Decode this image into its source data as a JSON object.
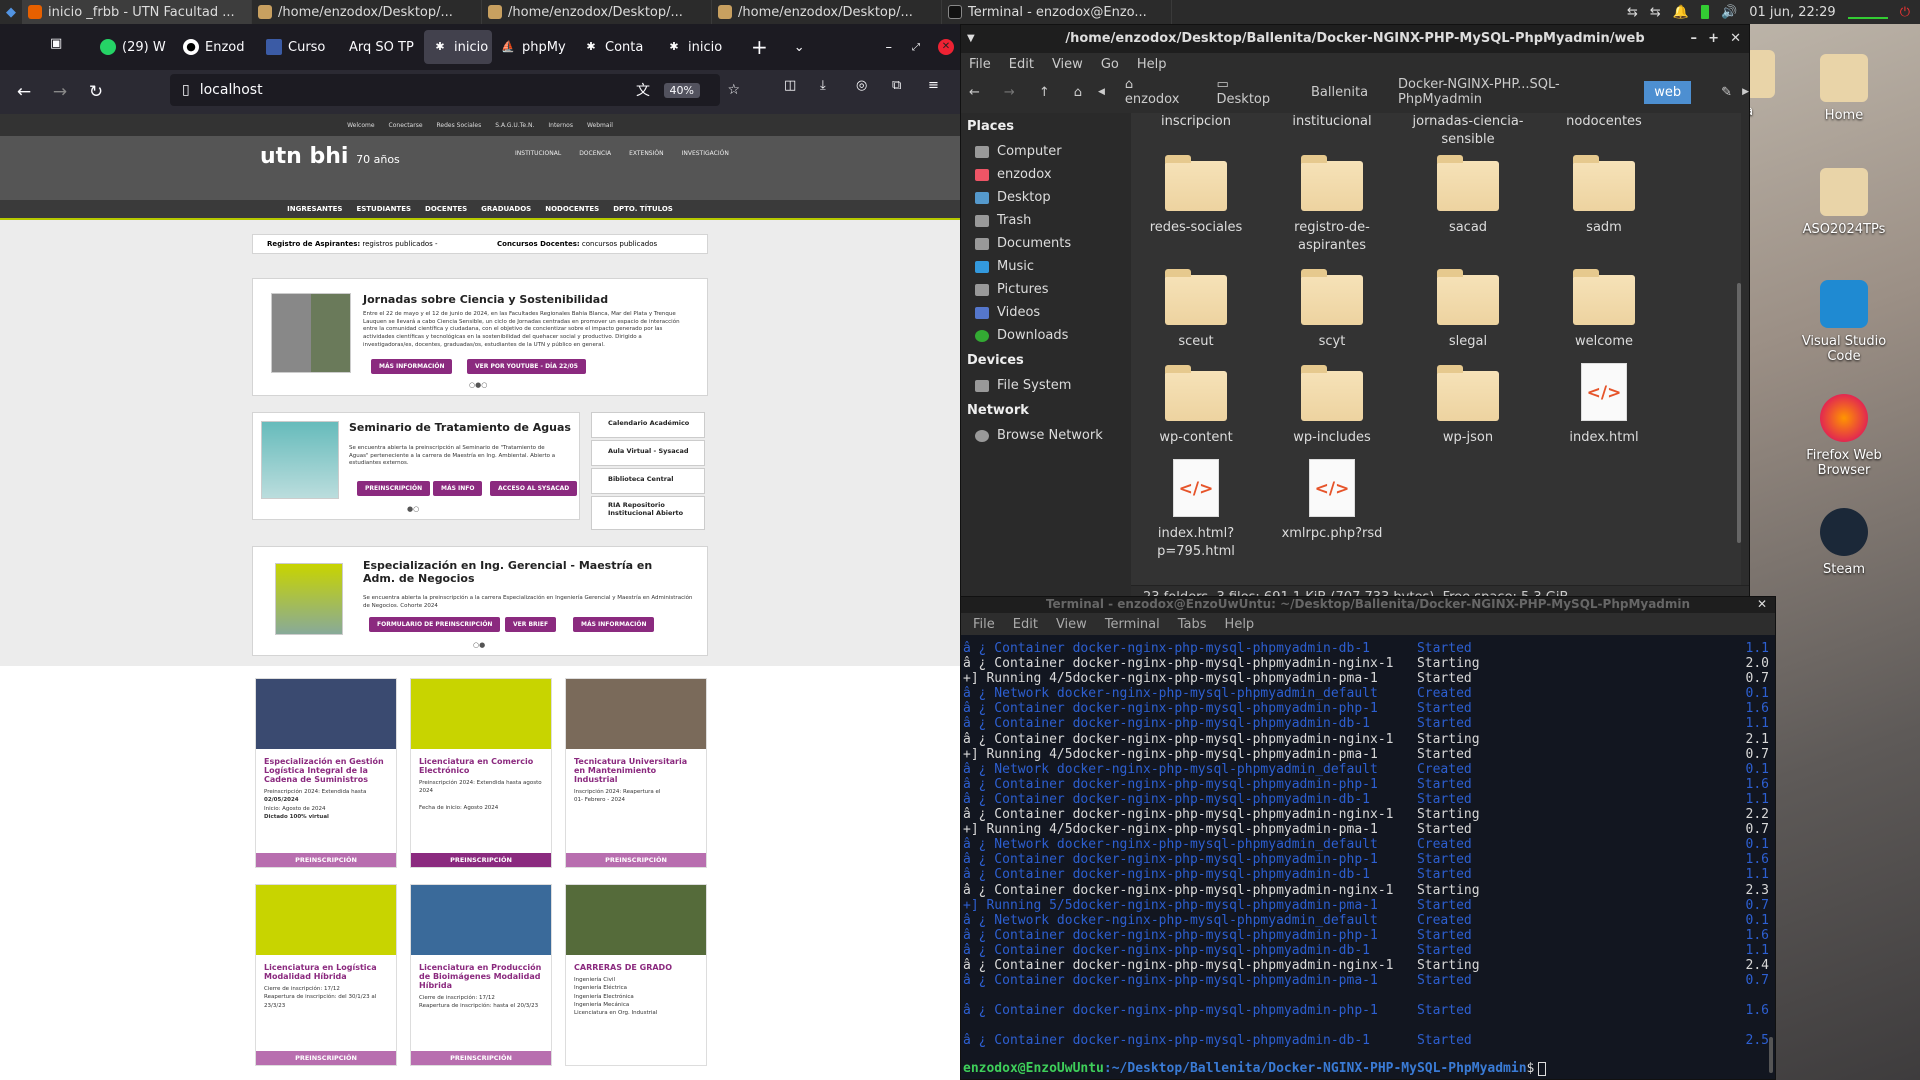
{
  "top_panel": {
    "tasks": [
      {
        "label": "inicio _frbb - UTN Facultad ...",
        "icon": "firefox-icon",
        "color": "#e66000"
      },
      {
        "label": "/home/enzodox/Desktop/...",
        "icon": "folder-icon",
        "color": "#c8a060"
      },
      {
        "label": "/home/enzodox/Desktop/...",
        "icon": "folder-icon",
        "color": "#c8a060"
      },
      {
        "label": "/home/enzodox/Desktop/...",
        "icon": "folder-icon",
        "color": "#c8a060"
      },
      {
        "label": "Terminal - enzodox@Enzo...",
        "icon": "terminal-icon",
        "color": "#333333"
      }
    ],
    "clock": "01 jun, 22:29"
  },
  "desktop_icons": [
    {
      "label": "Home"
    },
    {
      "label": "ASO2024TPs"
    },
    {
      "label": "Visual Studio Code"
    },
    {
      "label": "Firefox Web Browser"
    },
    {
      "label": "Steam"
    },
    {
      "label": "ta"
    }
  ],
  "firefox": {
    "tabs": [
      "(29) W",
      "Enzod",
      "Curso",
      "Arq SO TP",
      "inicio",
      "phpMy",
      "Conta",
      "inicio"
    ],
    "url": "localhost",
    "zoom": "40%"
  },
  "webpage": {
    "util_links": [
      "Welcome",
      "Conectarse",
      "Redes Sociales",
      "S.A.G.U.Te.N.",
      "Internos",
      "Webmail"
    ],
    "logo": "utn bhi",
    "logo_years": "70 años",
    "top_menu": [
      "INSTITUCIONAL",
      "DOCENCIA",
      "EXTENSIÓN",
      "INVESTIGACIÓN"
    ],
    "main_menu": [
      "INGRESANTES",
      "ESTUDIANTES",
      "DOCENTES",
      "GRADUADOS",
      "NODOCENTES",
      "DPTO. TÍTULOS"
    ],
    "ticker_left_bold": "Registro de Aspirantes:",
    "ticker_left": "registros publicados -",
    "ticker_right_bold": "Concursos Docentes:",
    "ticker_right": "concursos publicados",
    "slide1": {
      "title": "Jornadas sobre Ciencia y Sostenibilidad",
      "text": "Entre el 22 de mayo y el 12 de junio de 2024, en las Facultades Regionales Bahía Blanca, Mar del Plata y Trenque Lauquen se llevará a cabo Ciencia Sensible, un ciclo de Jornadas centradas en promover un espacio de interacción entre la comunidad científica y ciudadana, con el objetivo de concientizar sobre el impacto generado por las actividades científicas y tecnológicas en la sostenibilidad del quehacer social y productivo. Dirigido a investigadoras/es, docentes, graduadas/os, estudiantes de la UTN y público en general.",
      "btn1": "MÁS INFORMACIÓN",
      "btn2": "VER POR YOUTUBE - DÍA 22/05"
    },
    "slide2": {
      "title": "Seminario de Tratamiento de Aguas",
      "text": "Se encuentra abierta la preinscripción al Seminario de \"Tratamiento de Aguas\" perteneciente a la carrera de Maestría en Ing. Ambiental. Abierto a estudiantes externos.",
      "btn1": "PREINSCRIPCIÓN",
      "btn2": "MÁS INFO",
      "btn3": "ACCESO AL SYSACAD"
    },
    "quick_links": [
      "Calendario Académico",
      "Aula Virtual - Sysacad",
      "Biblioteca Central",
      "RIA Repositorio Institucional Abierto"
    ],
    "slide3": {
      "title": "Especialización en Ing. Gerencial - Maestría en Adm. de Negocios",
      "text": "Se encuentra abierta la preinscripción a la carrera Especialización en Ingeniería Gerencial y Maestría en Administración de Negocios. Cohorte 2024",
      "btn1": "FORMULARIO DE PREINSCRIPCIÓN",
      "btn2": "VER BRIEF",
      "btn3": "MÁS INFORMACIÓN"
    },
    "program_cards": [
      {
        "title": "Especialización en Gestión Logística Integral de la Cadena de Suministros",
        "lines": [
          "Preinscripción 2024: Extendida hasta",
          "02/05/2024",
          "Inicio: Agosto de 2024",
          "Dictado 100% virtual"
        ],
        "button": "PREINSCRIPCIÓN",
        "img": "#3a4a70"
      },
      {
        "title": "Licenciatura en Comercio Electrónico",
        "lines": [
          "Preinscripción 2024: Extendida hasta agosto 2024",
          "",
          "Fecha de inicio: Agosto 2024"
        ],
        "button": "PREINSCRIPCIÓN",
        "img": "#c8d400"
      },
      {
        "title": "Tecnicatura Universitaria en Mantenimiento Industrial",
        "lines": [
          "Inscripción 2024: Reapertura el",
          "01- Febrero - 2024"
        ],
        "button": "PREINSCRIPCIÓN",
        "img": "#7a6a5a"
      },
      {
        "title": "Licenciatura en Logística Modalidad Híbrida",
        "lines": [
          "Cierre de inscripción: 17/12",
          "Reapertura de inscripción: del 30/1/23 al 23/3/23"
        ],
        "button": "PREINSCRIPCIÓN",
        "img": "#c8d400"
      },
      {
        "title": "Licenciatura en Producción de Bioimágenes Modalidad Híbrida",
        "lines": [
          "Cierre de inscripción: 17/12",
          "Reapertura de inscripción: hasta el 20/3/23"
        ],
        "button": "PREINSCRIPCIÓN",
        "img": "#3a6a9a"
      },
      {
        "title": "CARRERAS DE GRADO",
        "lines": [
          "Ingeniería Civil",
          "Ingeniería Eléctrica",
          "Ingeniería Electrónica",
          "Ingeniería Mecánica",
          "Licenciatura en Org. Industrial"
        ],
        "button": "",
        "img": "#556b3a"
      }
    ]
  },
  "file_manager": {
    "title": "/home/enzodox/Desktop/Ballenita/Docker-NGINX-PHP-MySQL-PhpMyadmin/web",
    "menu": [
      "File",
      "Edit",
      "View",
      "Go",
      "Help"
    ],
    "breadcrumbs": [
      "enzodox",
      "Desktop",
      "Ballenita",
      "Docker-NGINX-PHP...SQL-PhpMyadmin",
      "web"
    ],
    "places_header": "Places",
    "places": [
      "Computer",
      "enzodox",
      "Desktop",
      "Trash",
      "Documents",
      "Music",
      "Pictures",
      "Videos",
      "Downloads"
    ],
    "devices_header": "Devices",
    "devices": [
      "File System"
    ],
    "network_header": "Network",
    "network": [
      "Browse Network"
    ],
    "top_row": [
      "inscripcion",
      "institucional",
      "jornadas-ciencia-\nsensible",
      "nodocentes"
    ],
    "items": [
      {
        "name": "redes-sociales",
        "type": "folder"
      },
      {
        "name": "registro-de-\naspirantes",
        "type": "folder"
      },
      {
        "name": "sacad",
        "type": "folder"
      },
      {
        "name": "sadm",
        "type": "folder"
      },
      {
        "name": "sceut",
        "type": "folder"
      },
      {
        "name": "scyt",
        "type": "folder"
      },
      {
        "name": "slegal",
        "type": "folder"
      },
      {
        "name": "welcome",
        "type": "folder"
      },
      {
        "name": "wp-content",
        "type": "folder"
      },
      {
        "name": "wp-includes",
        "type": "folder"
      },
      {
        "name": "wp-json",
        "type": "folder"
      },
      {
        "name": "index.html",
        "type": "html"
      },
      {
        "name": "index.html?\np=795.html",
        "type": "html"
      },
      {
        "name": "xmlrpc.php?rsd",
        "type": "html"
      }
    ],
    "status": "23 folders, 3 files: 691,1 KiB (707.733 bytes), Free space: 5,3 GiB"
  },
  "terminal": {
    "title": "Terminal - enzodox@EnzoUwUntu: ~/Desktop/Ballenita/Docker-NGINX-PHP-MySQL-PhpMyadmin",
    "menu": [
      "File",
      "Edit",
      "View",
      "Terminal",
      "Tabs",
      "Help"
    ],
    "lines": [
      {
        "t": "â ¿ Container docker-nginx-php-mysql-phpmyadmin-db-1      Started",
        "c": "b",
        "n": "1.1"
      },
      {
        "t": "â ¿ Container docker-nginx-php-mysql-phpmyadmin-nginx-1   Starting",
        "c": "w",
        "n": "2.0"
      },
      {
        "t": "+] Running 4/5docker-nginx-php-mysql-phpmyadmin-pma-1     Started",
        "c": "w",
        "n": "0.7"
      },
      {
        "t": "â ¿ Network docker-nginx-php-mysql-phpmyadmin_default     Created",
        "c": "b",
        "n": "0.1"
      },
      {
        "t": "â ¿ Container docker-nginx-php-mysql-phpmyadmin-php-1     Started",
        "c": "b",
        "n": "1.6"
      },
      {
        "t": "â ¿ Container docker-nginx-php-mysql-phpmyadmin-db-1      Started",
        "c": "b",
        "n": "1.1"
      },
      {
        "t": "â ¿ Container docker-nginx-php-mysql-phpmyadmin-nginx-1   Starting",
        "c": "w",
        "n": "2.1"
      },
      {
        "t": "+] Running 4/5docker-nginx-php-mysql-phpmyadmin-pma-1     Started",
        "c": "w",
        "n": "0.7"
      },
      {
        "t": "â ¿ Network docker-nginx-php-mysql-phpmyadmin_default     Created",
        "c": "b",
        "n": "0.1"
      },
      {
        "t": "â ¿ Container docker-nginx-php-mysql-phpmyadmin-php-1     Started",
        "c": "b",
        "n": "1.6"
      },
      {
        "t": "â ¿ Container docker-nginx-php-mysql-phpmyadmin-db-1      Started",
        "c": "b",
        "n": "1.1"
      },
      {
        "t": "â ¿ Container docker-nginx-php-mysql-phpmyadmin-nginx-1   Starting",
        "c": "w",
        "n": "2.2"
      },
      {
        "t": "+] Running 4/5docker-nginx-php-mysql-phpmyadmin-pma-1     Started",
        "c": "w",
        "n": "0.7"
      },
      {
        "t": "â ¿ Network docker-nginx-php-mysql-phpmyadmin_default     Created",
        "c": "b",
        "n": "0.1"
      },
      {
        "t": "â ¿ Container docker-nginx-php-mysql-phpmyadmin-php-1     Started",
        "c": "b",
        "n": "1.6"
      },
      {
        "t": "â ¿ Container docker-nginx-php-mysql-phpmyadmin-db-1      Started",
        "c": "b",
        "n": "1.1"
      },
      {
        "t": "â ¿ Container docker-nginx-php-mysql-phpmyadmin-nginx-1   Starting",
        "c": "w",
        "n": "2.3"
      },
      {
        "t": "+] Running 5/5docker-nginx-php-mysql-phpmyadmin-pma-1     Started",
        "c": "b",
        "n": "0.7"
      },
      {
        "t": "â ¿ Network docker-nginx-php-mysql-phpmyadmin_default     Created",
        "c": "b",
        "n": "0.1"
      },
      {
        "t": "â ¿ Container docker-nginx-php-mysql-phpmyadmin-php-1     Started",
        "c": "b",
        "n": "1.6"
      },
      {
        "t": "â ¿ Container docker-nginx-php-mysql-phpmyadmin-db-1      Started",
        "c": "b",
        "n": "1.1"
      },
      {
        "t": "â ¿ Container docker-nginx-php-mysql-phpmyadmin-nginx-1   Starting",
        "c": "w",
        "n": "2.4"
      },
      {
        "t": "â ¿ Container docker-nginx-php-mysql-phpmyadmin-pma-1     Started",
        "c": "b",
        "n": "0.7"
      },
      {
        "t": "",
        "c": "b",
        "n": ""
      },
      {
        "t": "â ¿ Container docker-nginx-php-mysql-phpmyadmin-php-1     Started",
        "c": "b",
        "n": "1.6"
      },
      {
        "t": "",
        "c": "b",
        "n": ""
      },
      {
        "t": "â ¿ Container docker-nginx-php-mysql-phpmyadmin-db-1      Started",
        "c": "b",
        "n": "2.5"
      }
    ],
    "prompt_user": "enzodox@EnzoUwUntu",
    "prompt_path": ":~/Desktop/Ballenita/Docker-NGINX-PHP-MySQL-PhpMyadmin",
    "prompt_end": "$"
  }
}
